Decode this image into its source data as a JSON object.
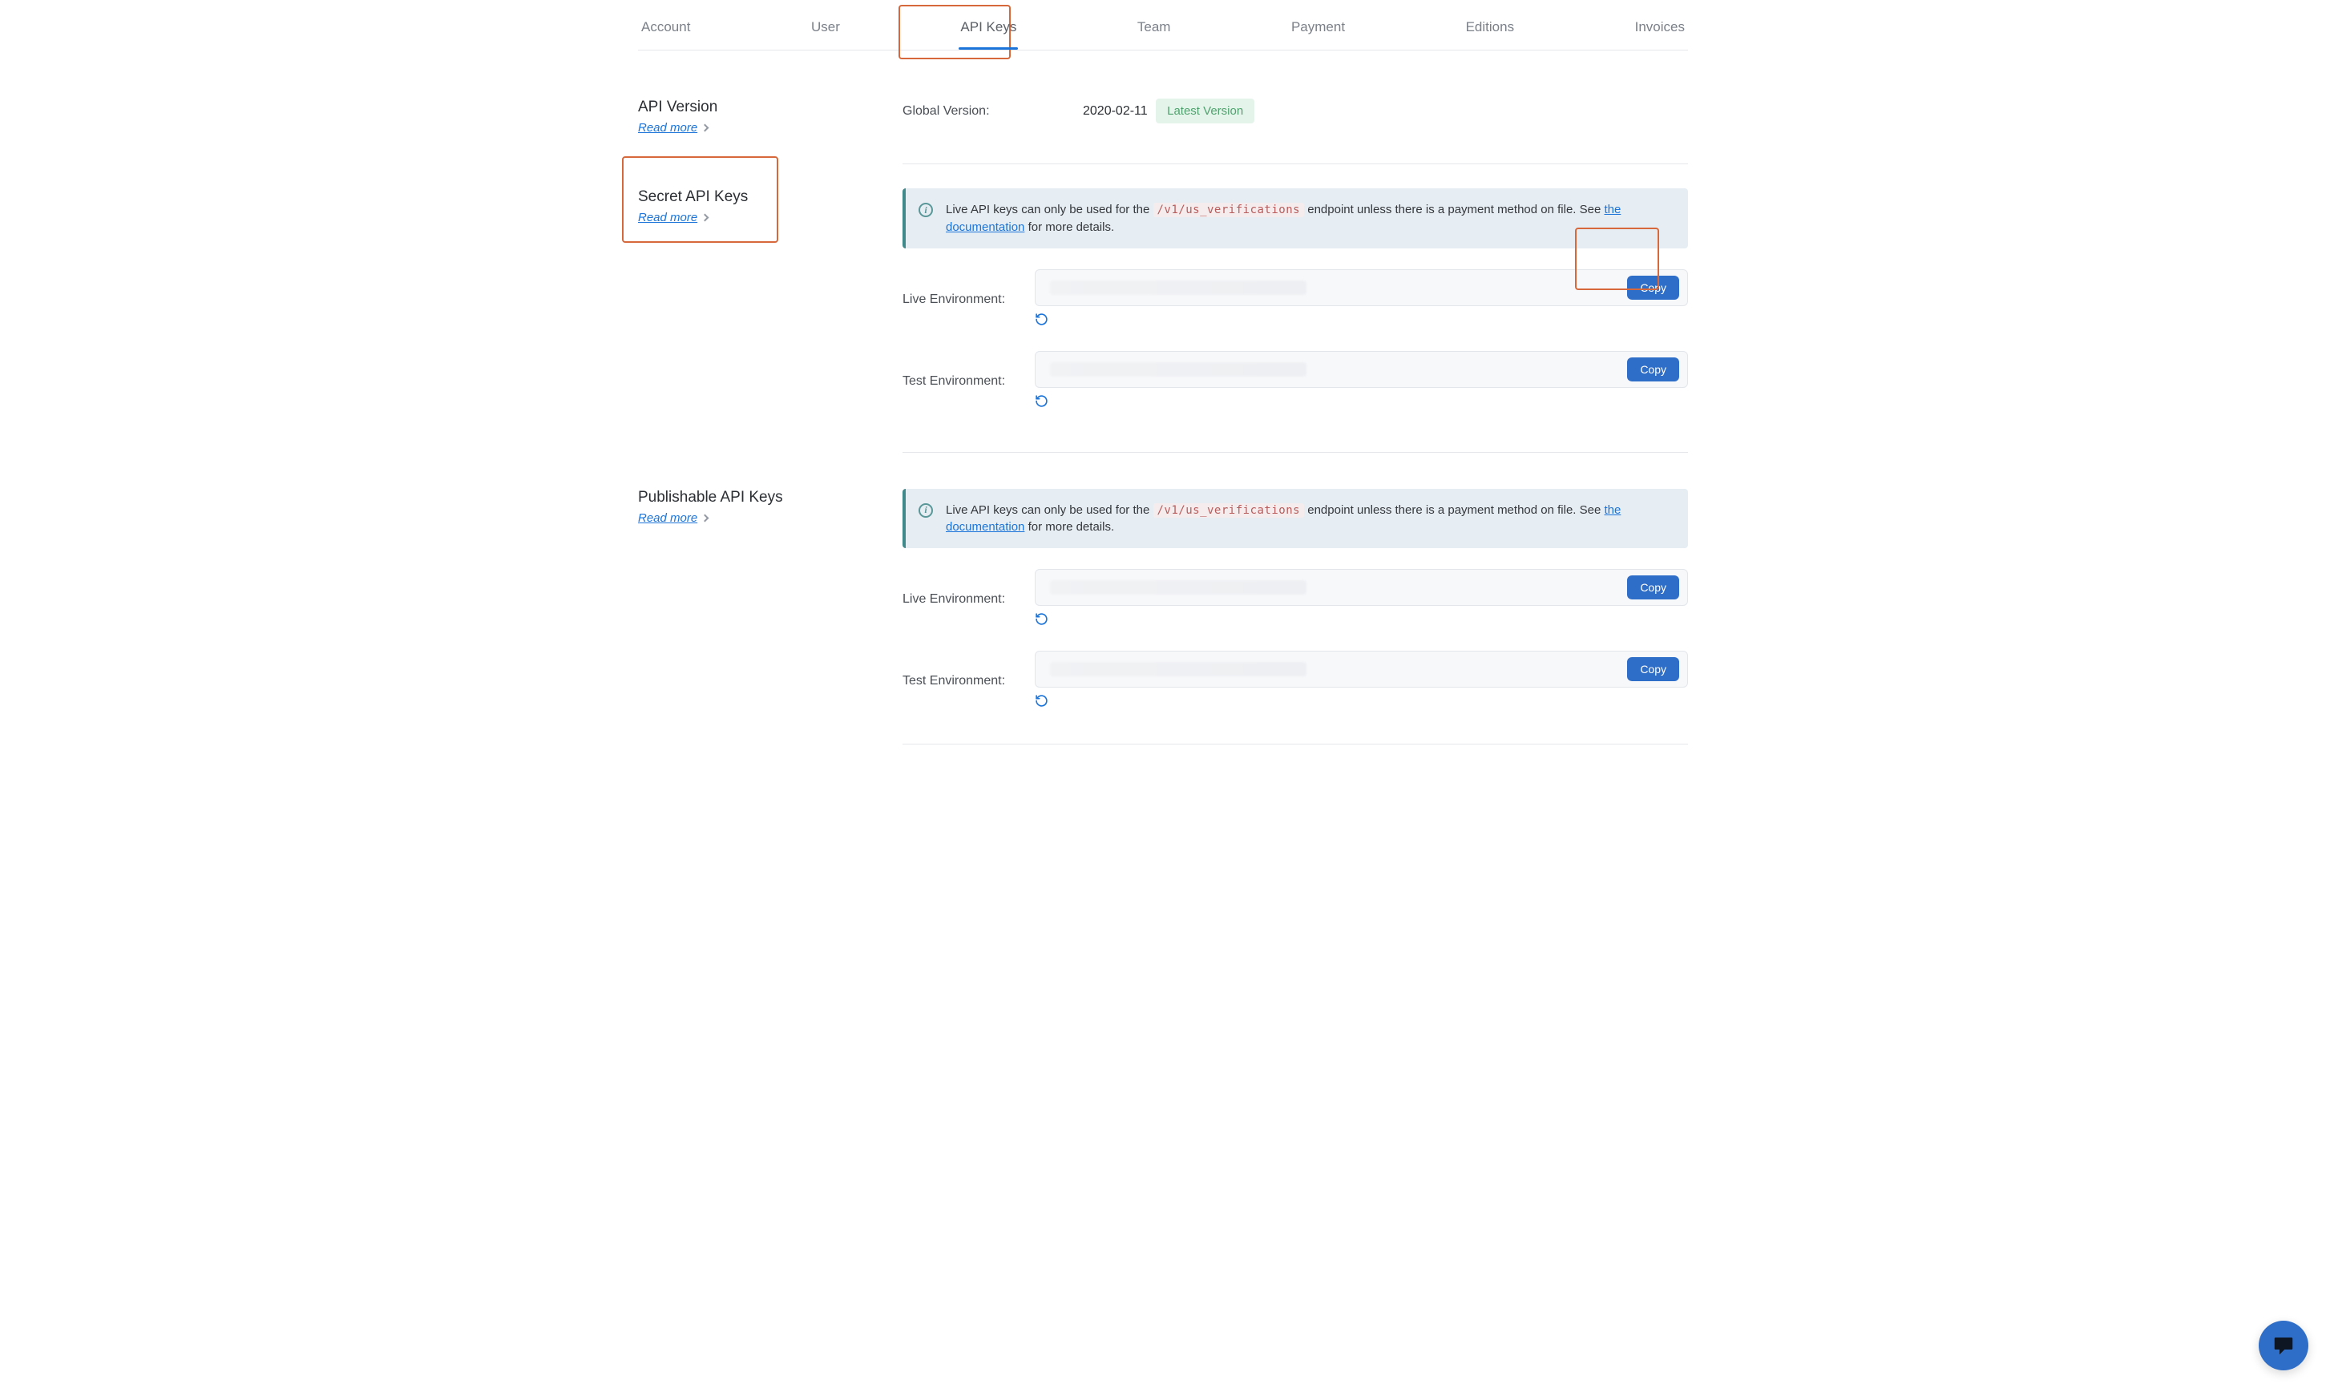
{
  "tabs": {
    "items": [
      {
        "label": "Account"
      },
      {
        "label": "User"
      },
      {
        "label": "API Keys",
        "active": true
      },
      {
        "label": "Team"
      },
      {
        "label": "Payment"
      },
      {
        "label": "Editions"
      },
      {
        "label": "Invoices"
      }
    ]
  },
  "api_version": {
    "title": "API Version",
    "read_more": "Read more",
    "global_label": "Global Version:",
    "date": "2020-02-11",
    "badge": "Latest Version"
  },
  "secret_keys": {
    "title": "Secret API Keys",
    "read_more": "Read more",
    "info_prefix": "Live API keys can only be used for the ",
    "info_code": "/v1/us_verifications",
    "info_suffix_1": " endpoint unless there is a payment method on file. See ",
    "info_link": "the documentation",
    "info_suffix_2": " for more details.",
    "live_label": "Live Environment:",
    "test_label": "Test Environment:",
    "copy": "Copy"
  },
  "publishable_keys": {
    "title": "Publishable API Keys",
    "read_more": "Read more",
    "info_prefix": "Live API keys can only be used for the ",
    "info_code": "/v1/us_verifications",
    "info_suffix_1": " endpoint unless there is a payment method on file. See ",
    "info_link": "the documentation",
    "info_suffix_2": " for more details.",
    "live_label": "Live Environment:",
    "test_label": "Test Environment:",
    "copy": "Copy"
  }
}
